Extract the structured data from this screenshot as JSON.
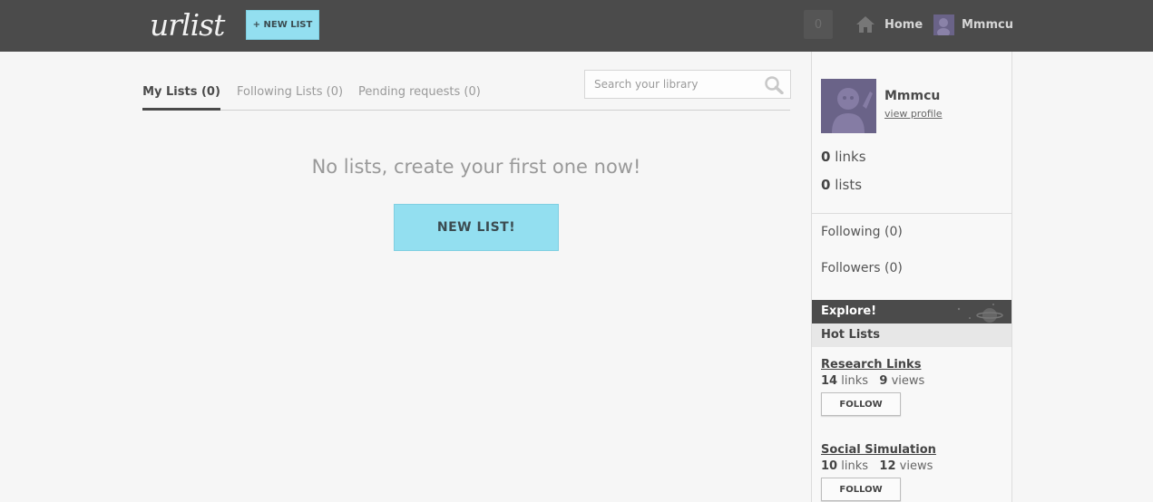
{
  "header": {
    "logo": "urlist",
    "new_list_label": "+ NEW LIST",
    "notifications_count": "0",
    "home_label": "Home",
    "username": "Mmmcu"
  },
  "tabs": [
    {
      "label": "My Lists (0)",
      "active": true
    },
    {
      "label": "Following Lists (0)",
      "active": false
    },
    {
      "label": "Pending requests (0)",
      "active": false
    }
  ],
  "search": {
    "placeholder": "Search your library"
  },
  "main": {
    "empty_message": "No lists, create your first one now!",
    "new_list_button": "NEW LIST!"
  },
  "sidebar": {
    "profile": {
      "name": "Mmmcu",
      "view_profile": "view profile",
      "links_count": "0",
      "links_label": "links",
      "lists_count": "0",
      "lists_label": "lists"
    },
    "following": {
      "label": "Following",
      "count": "0"
    },
    "followers": {
      "label": "Followers",
      "count": "0"
    },
    "explore_label": "Explore!",
    "hot_lists_label": "Hot Lists",
    "hot_lists": [
      {
        "title": "Research Links",
        "links": "14",
        "links_label": "links",
        "views": "9",
        "views_label": "views",
        "follow_label": "FOLLOW"
      },
      {
        "title": "Social Simulation",
        "links": "10",
        "links_label": "links",
        "views": "12",
        "views_label": "views",
        "follow_label": "FOLLOW"
      }
    ]
  },
  "colors": {
    "topbar": "#4b4b4b",
    "accent_button": "#93dff0",
    "avatar": "#6a6388",
    "background": "#f6f6f6"
  },
  "icons": [
    "home-icon",
    "search-icon",
    "avatar-image",
    "planet-icon"
  ]
}
